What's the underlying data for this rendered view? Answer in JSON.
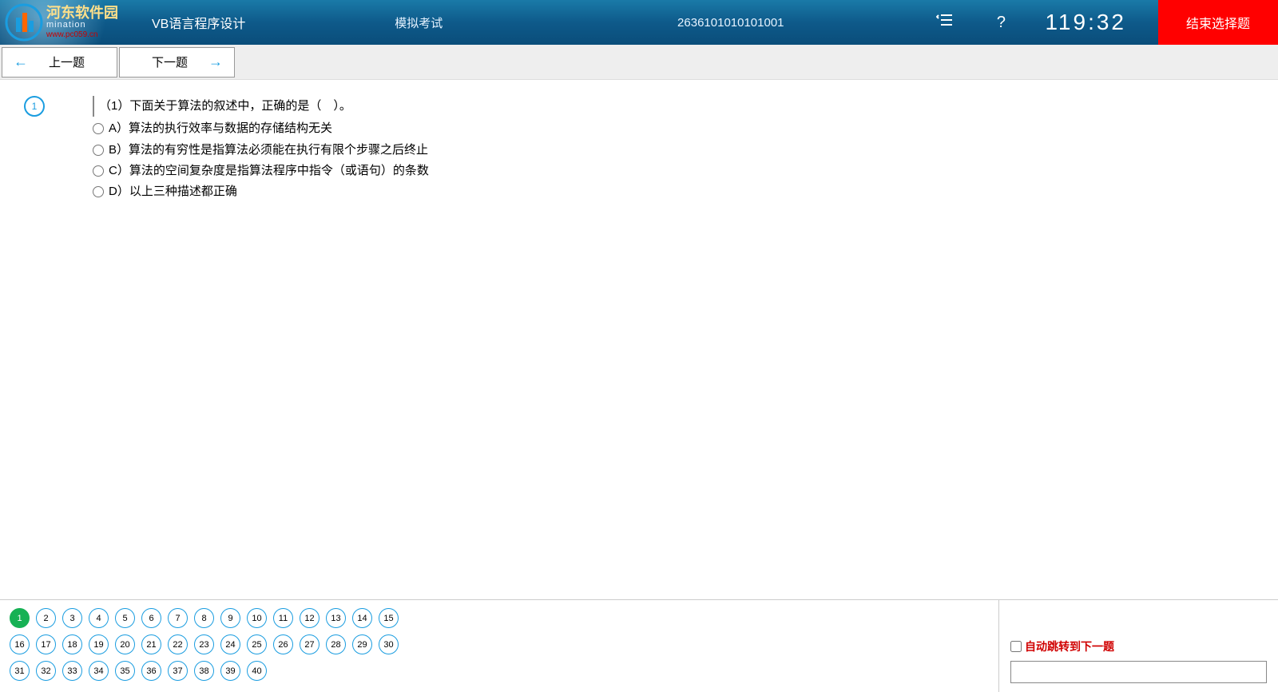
{
  "header": {
    "logo_top": "河东软件园",
    "logo_mid": "mination",
    "logo_url": "www.pc059.cn",
    "subject": "VB语言程序设计",
    "exam_mode": "模拟考试",
    "exam_id": "2636101010101001",
    "timer": "119:32",
    "end_label": "结束选择题"
  },
  "nav": {
    "prev": "上一题",
    "next": "下一题"
  },
  "question": {
    "number": "1",
    "stem": "（1）下面关于算法的叙述中，正确的是（　）。",
    "options": [
      "A）算法的执行效率与数据的存储结构无关",
      "B）算法的有穷性是指算法必须能在执行有限个步骤之后终止",
      "C）算法的空间复杂度是指算法程序中指令（或语句）的条数",
      "D）以上三种描述都正确"
    ]
  },
  "qnav": {
    "total": 40,
    "current": 1,
    "rows": [
      [
        1,
        2,
        3,
        4,
        5,
        6,
        7,
        8,
        9,
        10,
        11,
        12,
        13,
        14,
        15
      ],
      [
        16,
        17,
        18,
        19,
        20,
        21,
        22,
        23,
        24,
        25,
        26,
        27,
        28,
        29,
        30
      ],
      [
        31,
        32,
        33,
        34,
        35,
        36,
        37,
        38,
        39,
        40
      ]
    ]
  },
  "auto_jump_label": "自动跳转到下一题"
}
